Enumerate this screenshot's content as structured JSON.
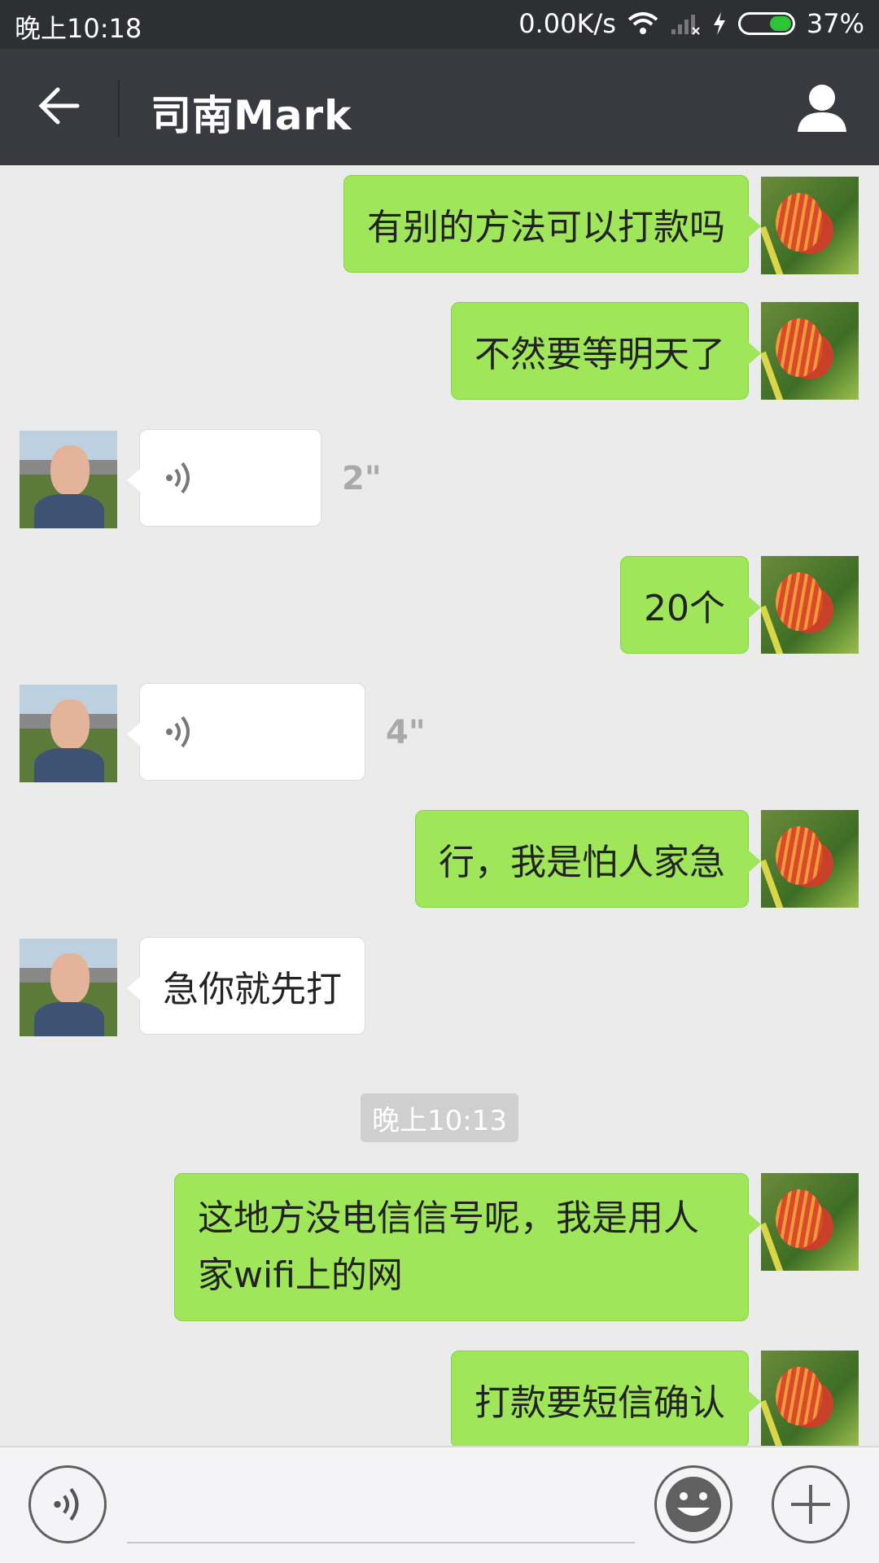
{
  "status_bar": {
    "time": "晚上10:18",
    "speed": "0.00K/s",
    "battery": "37%"
  },
  "nav": {
    "title": "司南Mark"
  },
  "messages": [
    {
      "side": "me",
      "text": "有别的方法可以打款吗"
    },
    {
      "side": "me",
      "text": "不然要等明天了"
    },
    {
      "side": "other",
      "type": "voice",
      "duration": "2\""
    },
    {
      "side": "me",
      "text": "20个"
    },
    {
      "side": "other",
      "type": "voice",
      "duration": "4\""
    },
    {
      "side": "me",
      "text": "行，我是怕人家急"
    },
    {
      "side": "other",
      "text": "急你就先打"
    },
    {
      "type": "time",
      "text": "晚上10:13"
    },
    {
      "side": "me",
      "text": "这地方没电信信号呢，我是用人家wifi上的网"
    },
    {
      "side": "me",
      "text": "打款要短信确认"
    }
  ],
  "input_bar": {
    "voice_icon": "voice-icon",
    "emoji_icon": "emoji-icon",
    "plus_icon": "plus-icon"
  },
  "colors": {
    "my_bubble": "#9fe65a",
    "other_bubble": "#ffffff",
    "nav_bg": "#393a3f",
    "status_bg": "#2e2f33",
    "chat_bg": "#ebebeb"
  }
}
